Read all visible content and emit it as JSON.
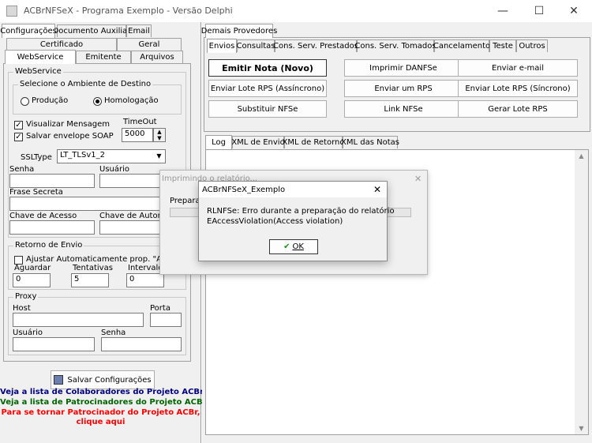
{
  "window": {
    "title": "ACBrNFSeX - Programa Exemplo - Versão Delphi",
    "min": "—",
    "max": "☐",
    "close": "✕"
  },
  "left_tabs_row1": [
    "Configurações",
    "Documento Auxiliar",
    "Email"
  ],
  "left_tabs_row2": [
    "Certificado",
    "Geral"
  ],
  "left_tabs_row3": [
    "WebService",
    "Emitente",
    "Arquivos"
  ],
  "webservice": {
    "group_label": "WebService",
    "ambiente_label": "Selecione o Ambiente de Destino",
    "producao": "Produção",
    "homologacao": "Homologação",
    "visualizar": "Visualizar Mensagem",
    "salvar_envelope": "Salvar envelope SOAP",
    "timeout_label": "TimeOut",
    "timeout_value": "5000",
    "ssltype_label": "SSLType",
    "ssltype_value": "LT_TLSv1_2",
    "senha": "Senha",
    "usuario": "Usuário",
    "frase": "Frase Secreta",
    "chave_acesso": "Chave de Acesso",
    "chave_autoriz": "Chave de Autoriza"
  },
  "retorno": {
    "label": "Retorno de Envio",
    "ajustar": "Ajustar Automaticamente prop. \"Aguarda",
    "aguardar": "Aguardar",
    "tentativas": "Tentativas",
    "intervalo": "Intervalo",
    "aguardar_val": "0",
    "tentativas_val": "5",
    "intervalo_val": "0"
  },
  "proxy": {
    "label": "Proxy",
    "host": "Host",
    "porta": "Porta",
    "usuario": "Usuário",
    "senha": "Senha"
  },
  "salvar_config": "Salvar Configurações",
  "links": {
    "colaboradores": "Veja a lista de Colaboradores do Projeto ACBr",
    "patrocinadores": "Veja a lista de Patrocinadores do Projeto ACBr",
    "tornar1": "Para se tornar Patrocinador do Projeto ACBr,",
    "tornar2": "clique aqui"
  },
  "right_tab_top": "Demais Provedores",
  "right_tabs": [
    "Envios",
    "Consultas",
    "Cons. Serv. Prestados",
    "Cons. Serv. Tomados",
    "Cancelamento",
    "Teste",
    "Outros"
  ],
  "buttons": {
    "emitir": "Emitir Nota (Novo)",
    "imprimir": "Imprimir DANFSe",
    "email": "Enviar e-mail",
    "lote_async": "Enviar Lote RPS (Assíncrono)",
    "enviar_um": "Enviar um RPS",
    "lote_sync": "Enviar Lote RPS (Síncrono)",
    "substituir": "Substituir NFSe",
    "link": "Link NFSe",
    "gerar": "Gerar Lote RPS"
  },
  "log_tabs": [
    "Log",
    "XML de Envio",
    "XML de Retorno",
    "XML das Notas"
  ],
  "progress_dialog": {
    "title": "Imprimindo o relatório...",
    "text": "Preparand",
    "close": "✕"
  },
  "error_dialog": {
    "title": "ACBrNFSeX_Exemplo",
    "line1": "RLNFSe: Erro durante a preparação do relatório",
    "line2": "EAccessViolation(Access violation)",
    "ok": "OK",
    "close": "✕"
  }
}
